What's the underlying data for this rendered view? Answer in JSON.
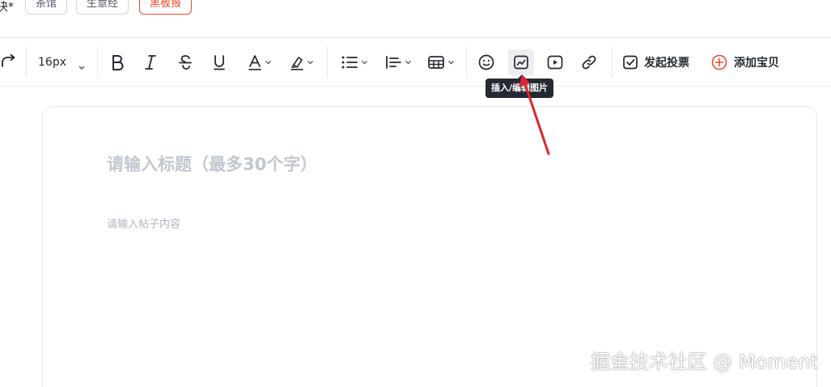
{
  "tags": {
    "cut_label": "决*",
    "items": [
      {
        "label": "茶馆",
        "active": false
      },
      {
        "label": "生意经",
        "active": false
      },
      {
        "label": "黑板报",
        "active": true
      }
    ]
  },
  "toolbar": {
    "font_size": "16px",
    "vote_label": "发起投票",
    "add_item_label": "添加宝贝",
    "icons": [
      "redo-icon",
      "bold-icon",
      "italic-icon",
      "strikethrough-icon",
      "underline-icon",
      "font-color-icon",
      "highlight-icon",
      "list-icon",
      "align-icon",
      "table-icon",
      "emoji-icon",
      "image-icon",
      "video-icon",
      "link-icon",
      "vote-icon",
      "add-circle-icon"
    ]
  },
  "tooltip": {
    "text": "插入/编辑图片"
  },
  "editor": {
    "title_placeholder": "请输入标题（最多30个字）",
    "content_placeholder": "请输入帖子内容"
  },
  "watermark": "掘金技术社区 @ Moment",
  "colors": {
    "accent": "#f04a2b",
    "annotation_arrow": "#e0242f",
    "tooltip_bg": "#252933",
    "placeholder": "#c2c8d1"
  }
}
